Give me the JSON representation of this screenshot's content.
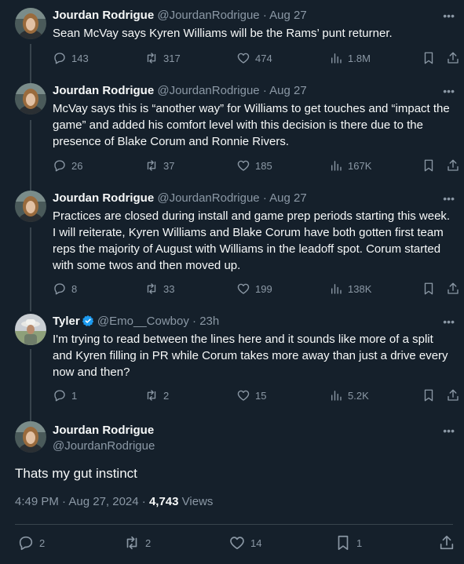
{
  "tweets": [
    {
      "name": "Jourdan Rodrigue",
      "handle": "@JourdanRodrigue",
      "sep": "·",
      "date": "Aug 27",
      "text": "Sean McVay says Kyren Williams will be the Rams’ punt returner.",
      "replies": "143",
      "retweets": "317",
      "likes": "474",
      "views": "1.8M"
    },
    {
      "name": "Jourdan Rodrigue",
      "handle": "@JourdanRodrigue",
      "sep": "·",
      "date": "Aug 27",
      "text": "McVay says this is “another way” for Williams to get touches and “impact the game” and added his comfort level with this decision is there due to the presence of Blake Corum and Ronnie Rivers.",
      "replies": "26",
      "retweets": "37",
      "likes": "185",
      "views": "167K"
    },
    {
      "name": "Jourdan Rodrigue",
      "handle": "@JourdanRodrigue",
      "sep": "·",
      "date": "Aug 27",
      "text": "Practices are closed during install and game prep periods starting this week. I will reiterate, Kyren Williams and Blake Corum have both gotten first team reps the majority of August with Williams in the leadoff spot. Corum started with some twos and then moved up.",
      "replies": "8",
      "retweets": "33",
      "likes": "199",
      "views": "138K"
    },
    {
      "name": "Tyler",
      "handle": "@Emo__Cowboy",
      "sep": "·",
      "date": "23h",
      "text": "I'm trying to read between the lines here and it sounds like more of a split and Kyren filling in PR while Corum takes more away than just a drive every now and then?",
      "replies": "1",
      "retweets": "2",
      "likes": "15",
      "views": "5.2K"
    }
  ],
  "main": {
    "name": "Jourdan Rodrigue",
    "handle": "@JourdanRodrigue",
    "text": "Thats my gut instinct",
    "time": "4:49 PM · Aug 27, 2024 · ",
    "views_count": "4,743",
    "views_label": " Views",
    "replies": "2",
    "retweets": "2",
    "likes": "14",
    "bookmarks": "1"
  },
  "more_glyph": "•••",
  "colors": {
    "background": "#15202b",
    "secondary": "#8b98a5",
    "verified": "#1d9bf0",
    "divider": "#38444d"
  },
  "icons": [
    "reply-icon",
    "retweet-icon",
    "like-icon",
    "views-icon",
    "bookmark-icon",
    "share-icon",
    "more-icon",
    "verified-badge-icon"
  ]
}
